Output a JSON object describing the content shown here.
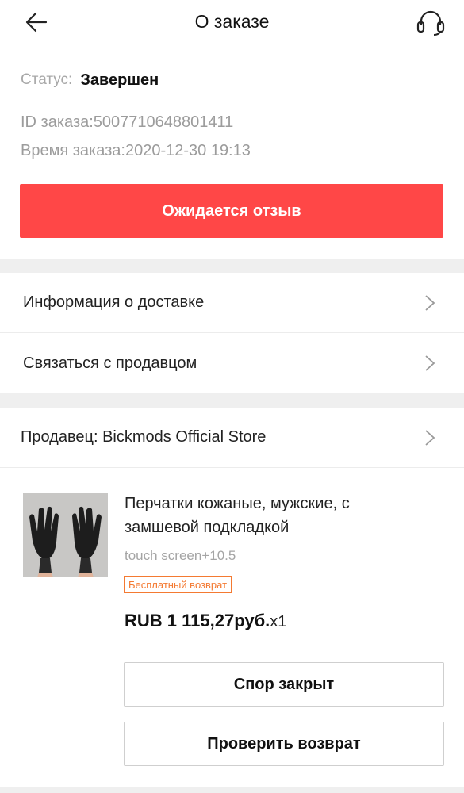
{
  "header": {
    "title": "О заказе",
    "back_icon": "arrow-left-icon",
    "support_icon": "headset-icon"
  },
  "order": {
    "status_label": "Статус:",
    "status_value": "Завершен",
    "id_line": "ID заказа:5007710648801411",
    "time_line": "Время заказа:2020-12-30 19:13"
  },
  "primary_action": {
    "label": "Ожидается отзыв",
    "color": "#ff4747"
  },
  "links": {
    "delivery": "Информация о доставке",
    "contact_seller": "Связаться с продавцом",
    "chevron_icon": "chevron-right-icon"
  },
  "seller": {
    "label": "Продавец: Bickmods Official Store"
  },
  "product": {
    "name": "Перчатки кожаные, мужские, с замшевой подкладкой",
    "variant": "touch screen+10.5",
    "badge": "Бесплатный возврат",
    "badge_color": "#f47a32",
    "price": "RUB 1 115,27руб.",
    "quantity": "x1",
    "image": "leather-gloves-photo"
  },
  "actions": {
    "dispute": "Спор закрыт",
    "check_return": "Проверить возврат"
  }
}
